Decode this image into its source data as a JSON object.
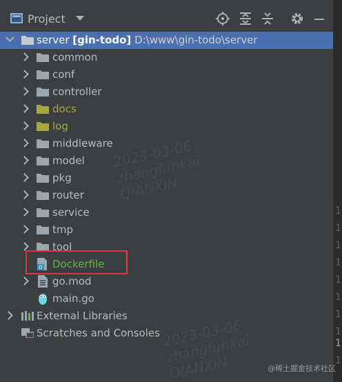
{
  "toolbar": {
    "title": "Project",
    "icons": [
      "project-view-icon",
      "chevron-down-icon",
      "locate-icon",
      "expand-all-icon",
      "collapse-all-icon",
      "gear-icon",
      "minimize-icon"
    ]
  },
  "tree": {
    "root": {
      "name": "server",
      "module": "[gin-todo]",
      "path": "D:\\www\\gin-todo\\server"
    },
    "folders": [
      {
        "label": "common",
        "style": "normal"
      },
      {
        "label": "conf",
        "style": "normal"
      },
      {
        "label": "controller",
        "style": "normal"
      },
      {
        "label": "docs",
        "style": "excluded"
      },
      {
        "label": "log",
        "style": "excluded"
      },
      {
        "label": "middleware",
        "style": "normal"
      },
      {
        "label": "model",
        "style": "normal"
      },
      {
        "label": "pkg",
        "style": "normal"
      },
      {
        "label": "router",
        "style": "normal"
      },
      {
        "label": "service",
        "style": "normal"
      },
      {
        "label": "tmp",
        "style": "normal"
      },
      {
        "label": "tool",
        "style": "normal"
      }
    ],
    "files": [
      {
        "label": "Dockerfile",
        "icon": "docker-file-icon"
      },
      {
        "label": "go.mod",
        "icon": "go-mod-file-icon"
      },
      {
        "label": "main.go",
        "icon": "go-gopher-file-icon"
      }
    ],
    "external_libraries": "External Libraries",
    "scratches": "Scratches and Consoles"
  },
  "watermarks": [
    "2023-03-06",
    "zhangfunkai",
    "QIANXIN"
  ],
  "credit": "@稀土掘金技术社区",
  "colors": {
    "selection": "#4b6eaf",
    "excluded": "#a8a842",
    "new_file": "#62b543",
    "highlight": "#e2363f"
  }
}
